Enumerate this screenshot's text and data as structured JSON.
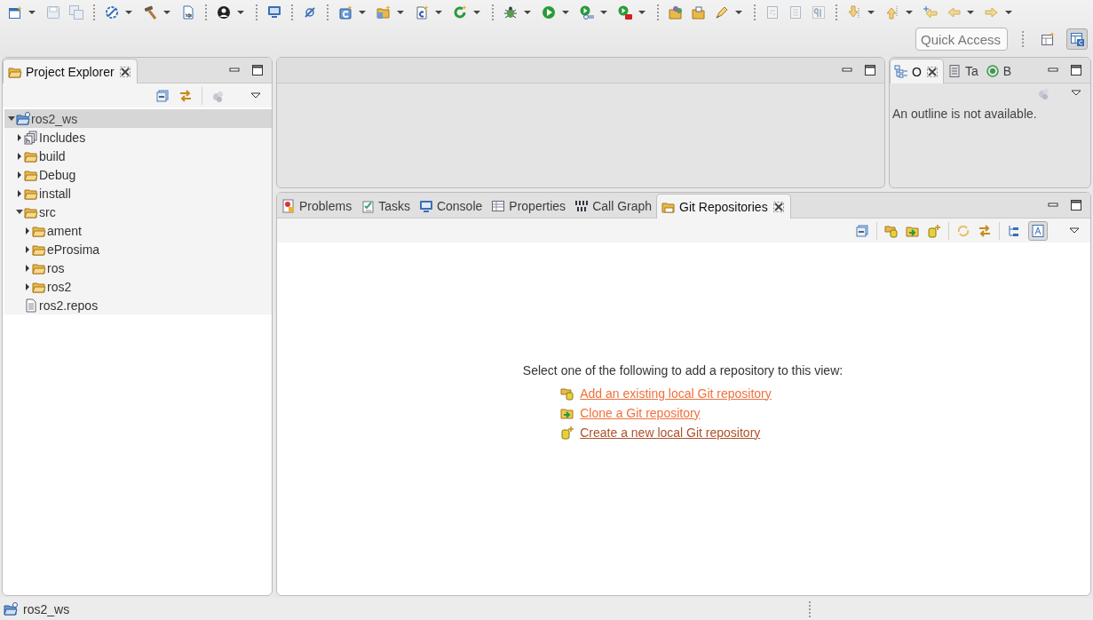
{
  "toolbar": {
    "quick_access": {
      "placeholder": "Quick Access"
    }
  },
  "project_explorer": {
    "tab": {
      "label": "Project Explorer",
      "selected": true
    },
    "tree": [
      {
        "label": "ros2_ws",
        "kind": "project",
        "expanded": true,
        "selected": true,
        "children": [
          {
            "label": "Includes",
            "kind": "includes",
            "expanded": false,
            "selected": false
          },
          {
            "label": "build",
            "kind": "folder",
            "expanded": false,
            "selected": false
          },
          {
            "label": "Debug",
            "kind": "folder",
            "expanded": false,
            "selected": false
          },
          {
            "label": "install",
            "kind": "folder",
            "expanded": false,
            "selected": false
          },
          {
            "label": "src",
            "kind": "folder",
            "expanded": true,
            "selected": false,
            "children": [
              {
                "label": "ament",
                "kind": "folder",
                "expanded": false,
                "selected": false
              },
              {
                "label": "eProsima",
                "kind": "folder",
                "expanded": false,
                "selected": false
              },
              {
                "label": "ros",
                "kind": "folder",
                "expanded": false,
                "selected": false
              },
              {
                "label": "ros2",
                "kind": "folder",
                "expanded": false,
                "selected": false
              }
            ]
          },
          {
            "label": "ros2.repos",
            "kind": "file",
            "selected": false
          }
        ]
      }
    ]
  },
  "outline": {
    "tabs": [
      {
        "label": "O",
        "selected": true
      },
      {
        "label": "Ta",
        "selected": false
      },
      {
        "label": "B",
        "selected": false
      }
    ],
    "message": "An outline is not available."
  },
  "bottom_panel": {
    "tabs": [
      {
        "label": "Problems",
        "selected": false
      },
      {
        "label": "Tasks",
        "selected": false
      },
      {
        "label": "Console",
        "selected": false
      },
      {
        "label": "Properties",
        "selected": false
      },
      {
        "label": "Call Graph",
        "selected": false
      },
      {
        "label": "Git Repositories",
        "selected": true
      }
    ],
    "message": "Select one of the following to add a repository to this view:",
    "links": [
      {
        "label": "Add an existing local Git repository",
        "focused": false
      },
      {
        "label": "Clone a Git repository",
        "focused": false
      },
      {
        "label": "Create a new local Git repository",
        "focused": true
      }
    ]
  },
  "status_bar": {
    "text": "ros2_ws"
  }
}
